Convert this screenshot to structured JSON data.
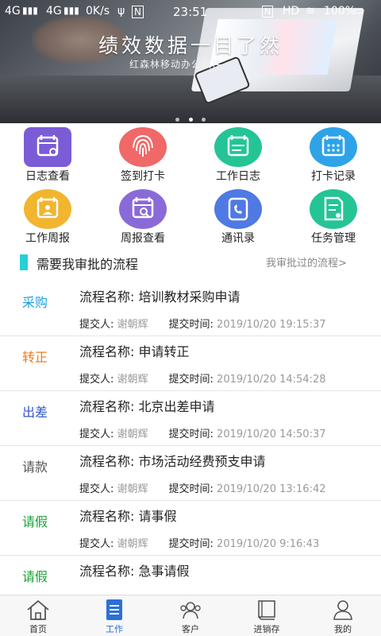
{
  "status_bar": {
    "signal1": "4G",
    "signal2": "4G",
    "speed": "0K/s",
    "time": "23:51",
    "hd": "HD",
    "battery": "100%"
  },
  "banner": {
    "title": "绩效数据一目了然",
    "subtitle": "红森林移动办公软件"
  },
  "grid": [
    {
      "label": "日志查看",
      "icon": "log-view-icon",
      "color": "#7b5cd6"
    },
    {
      "label": "签到打卡",
      "icon": "fingerprint-icon",
      "color": "#f06868"
    },
    {
      "label": "工作日志",
      "icon": "work-log-icon",
      "color": "#25c497"
    },
    {
      "label": "打卡记录",
      "icon": "checkin-record-icon",
      "color": "#2fa3e8"
    },
    {
      "label": "工作周报",
      "icon": "weekly-report-icon",
      "color": "#f2b530"
    },
    {
      "label": "周报查看",
      "icon": "weekly-view-icon",
      "color": "#8a6ad8"
    },
    {
      "label": "通讯录",
      "icon": "contacts-icon",
      "color": "#4f79e3"
    },
    {
      "label": "任务管理",
      "icon": "task-icon",
      "color": "#25c497"
    }
  ],
  "section": {
    "title": "需要我审批的流程",
    "link": "我审批过的流程>"
  },
  "labels": {
    "name_prefix": "流程名称: ",
    "submitter": "提交人: ",
    "submit_time": "提交时间: "
  },
  "items": [
    {
      "category": "采购",
      "cat_color": "#1da1e0",
      "name": "培训教材采购申请",
      "submitter": "谢朝辉",
      "time": "2019/10/20 19:15:37"
    },
    {
      "category": "转正",
      "cat_color": "#f07a1a",
      "name": "申请转正",
      "submitter": "谢朝辉",
      "time": "2019/10/20 14:54:28"
    },
    {
      "category": "出差",
      "cat_color": "#2f57c8",
      "name": "北京出差申请",
      "submitter": "谢朝辉",
      "time": "2019/10/20 14:50:37"
    },
    {
      "category": "请款",
      "cat_color": "#555555",
      "name": "市场活动经费预支申请",
      "submitter": "谢朝辉",
      "time": "2019/10/20 13:16:42"
    },
    {
      "category": "请假",
      "cat_color": "#17a534",
      "name": "请事假",
      "submitter": "谢朝辉",
      "time": "2019/10/20 9:16:43"
    },
    {
      "category": "请假",
      "cat_color": "#17a534",
      "name": "急事请假",
      "submitter": "",
      "time": ""
    }
  ],
  "tabs": [
    {
      "label": "首页",
      "icon": "home-icon",
      "active": false
    },
    {
      "label": "工作",
      "icon": "work-icon",
      "active": true
    },
    {
      "label": "客户",
      "icon": "customers-icon",
      "active": false
    },
    {
      "label": "进销存",
      "icon": "inventory-icon",
      "active": false
    },
    {
      "label": "我的",
      "icon": "profile-icon",
      "active": false
    }
  ],
  "colors": {
    "accent": "#2d6fd8",
    "section_bar": "#28d0d6"
  }
}
